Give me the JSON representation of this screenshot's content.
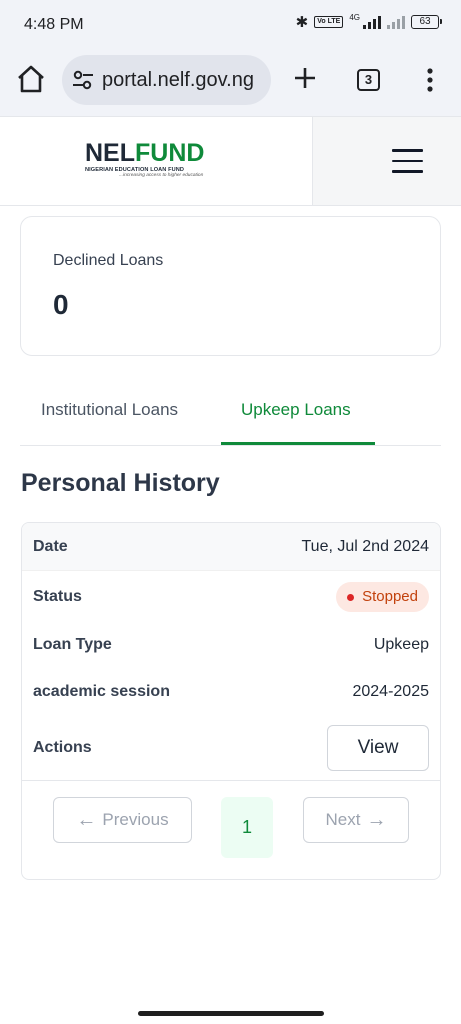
{
  "status_bar": {
    "time": "4:48 PM",
    "volte": "Vo LTE",
    "network": "4G",
    "battery": "63"
  },
  "browser": {
    "url": "portal.nelf.gov.ng",
    "tab_count": "3"
  },
  "header": {
    "logo_nel": "NEL",
    "logo_fund": "FUND",
    "logo_subtitle": "NIGERIAN EDUCATION LOAN FUND",
    "logo_tagline": "...increasing access to higher education"
  },
  "summary_card": {
    "label": "Declined Loans",
    "value": "0"
  },
  "tabs": [
    {
      "label": "Institutional Loans",
      "active": false
    },
    {
      "label": "Upkeep Loans",
      "active": true
    }
  ],
  "section_title": "Personal History",
  "history": {
    "date_label": "Date",
    "date_value": "Tue, Jul 2nd 2024",
    "status_label": "Status",
    "status_value": "Stopped",
    "loan_type_label": "Loan Type",
    "loan_type_value": "Upkeep",
    "session_label": "academic session",
    "session_value": "2024-2025",
    "actions_label": "Actions",
    "view_button": "View"
  },
  "pagination": {
    "previous": "Previous",
    "current_page": "1",
    "next": "Next"
  },
  "colors": {
    "brand_green": "#0f8a3a",
    "status_stopped_bg": "#fde8e2",
    "status_stopped_text": "#c2410c"
  },
  "icons": [
    "home-icon",
    "tune-icon",
    "plus-icon",
    "tabs-icon",
    "more-vert-icon",
    "hamburger-icon",
    "arrow-left-icon",
    "arrow-right-icon",
    "bluetooth-icon",
    "signal-icon",
    "battery-icon"
  ]
}
